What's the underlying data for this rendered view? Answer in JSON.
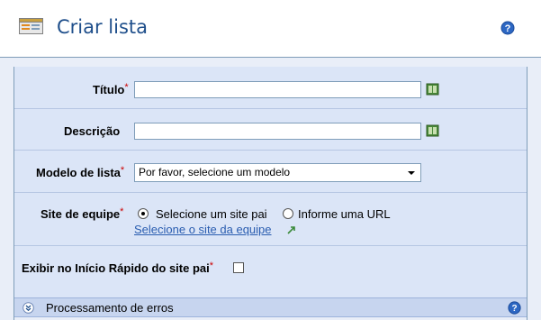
{
  "header": {
    "title": "Criar lista",
    "icon": "list-icon",
    "help_icon": "help-icon"
  },
  "form": {
    "title_field": {
      "label": "Título",
      "required_mark": "*",
      "value": ""
    },
    "description_field": {
      "label": "Descrição",
      "value": ""
    },
    "template_field": {
      "label": "Modelo de lista",
      "required_mark": "*",
      "selected": "Por favor, selecione um modelo"
    },
    "site_field": {
      "label": "Site de equipe",
      "required_mark": "*",
      "options": [
        {
          "label": "Selecione um site pai",
          "checked": true
        },
        {
          "label": "Informe uma URL",
          "checked": false
        }
      ],
      "link_label": "Selecione o site da equipe"
    },
    "quick_launch_field": {
      "label": "Exibir no Início Rápido do site pai",
      "required_mark": "*",
      "checked": false
    }
  },
  "section": {
    "title": "Processamento de erros",
    "collapse_icon": "chevron-double-down-icon",
    "help_icon": "help-icon"
  },
  "colors": {
    "accent": "#1f4f8b",
    "link": "#2a5db0",
    "required": "#cc0000",
    "form_bg": "#dbe5f7"
  }
}
